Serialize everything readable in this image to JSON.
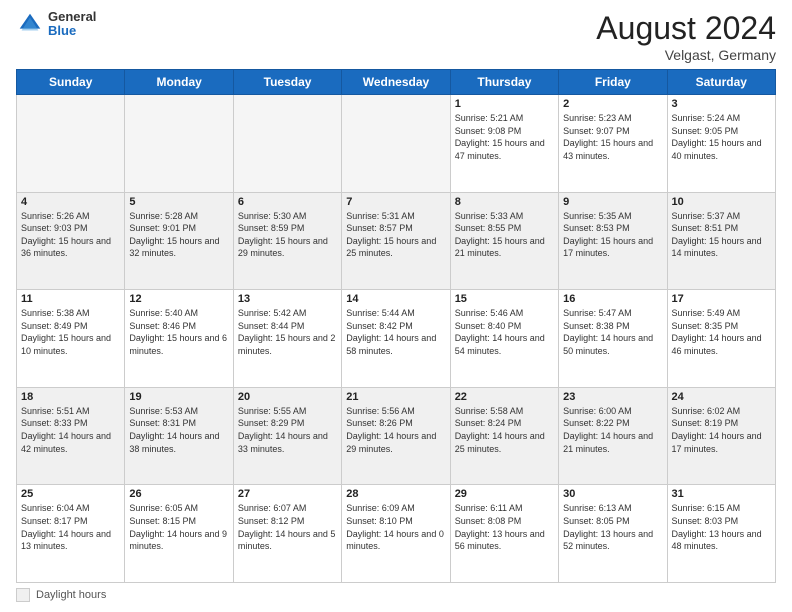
{
  "header": {
    "logo_general": "General",
    "logo_blue": "Blue",
    "title": "August 2024",
    "location": "Velgast, Germany"
  },
  "days_of_week": [
    "Sunday",
    "Monday",
    "Tuesday",
    "Wednesday",
    "Thursday",
    "Friday",
    "Saturday"
  ],
  "weeks": [
    [
      {
        "day": "",
        "info": "",
        "empty": true
      },
      {
        "day": "",
        "info": "",
        "empty": true
      },
      {
        "day": "",
        "info": "",
        "empty": true
      },
      {
        "day": "",
        "info": "",
        "empty": true
      },
      {
        "day": "1",
        "info": "Sunrise: 5:21 AM\nSunset: 9:08 PM\nDaylight: 15 hours and 47 minutes.",
        "empty": false
      },
      {
        "day": "2",
        "info": "Sunrise: 5:23 AM\nSunset: 9:07 PM\nDaylight: 15 hours and 43 minutes.",
        "empty": false
      },
      {
        "day": "3",
        "info": "Sunrise: 5:24 AM\nSunset: 9:05 PM\nDaylight: 15 hours and 40 minutes.",
        "empty": false
      }
    ],
    [
      {
        "day": "4",
        "info": "Sunrise: 5:26 AM\nSunset: 9:03 PM\nDaylight: 15 hours and 36 minutes.",
        "empty": false
      },
      {
        "day": "5",
        "info": "Sunrise: 5:28 AM\nSunset: 9:01 PM\nDaylight: 15 hours and 32 minutes.",
        "empty": false
      },
      {
        "day": "6",
        "info": "Sunrise: 5:30 AM\nSunset: 8:59 PM\nDaylight: 15 hours and 29 minutes.",
        "empty": false
      },
      {
        "day": "7",
        "info": "Sunrise: 5:31 AM\nSunset: 8:57 PM\nDaylight: 15 hours and 25 minutes.",
        "empty": false
      },
      {
        "day": "8",
        "info": "Sunrise: 5:33 AM\nSunset: 8:55 PM\nDaylight: 15 hours and 21 minutes.",
        "empty": false
      },
      {
        "day": "9",
        "info": "Sunrise: 5:35 AM\nSunset: 8:53 PM\nDaylight: 15 hours and 17 minutes.",
        "empty": false
      },
      {
        "day": "10",
        "info": "Sunrise: 5:37 AM\nSunset: 8:51 PM\nDaylight: 15 hours and 14 minutes.",
        "empty": false
      }
    ],
    [
      {
        "day": "11",
        "info": "Sunrise: 5:38 AM\nSunset: 8:49 PM\nDaylight: 15 hours and 10 minutes.",
        "empty": false
      },
      {
        "day": "12",
        "info": "Sunrise: 5:40 AM\nSunset: 8:46 PM\nDaylight: 15 hours and 6 minutes.",
        "empty": false
      },
      {
        "day": "13",
        "info": "Sunrise: 5:42 AM\nSunset: 8:44 PM\nDaylight: 15 hours and 2 minutes.",
        "empty": false
      },
      {
        "day": "14",
        "info": "Sunrise: 5:44 AM\nSunset: 8:42 PM\nDaylight: 14 hours and 58 minutes.",
        "empty": false
      },
      {
        "day": "15",
        "info": "Sunrise: 5:46 AM\nSunset: 8:40 PM\nDaylight: 14 hours and 54 minutes.",
        "empty": false
      },
      {
        "day": "16",
        "info": "Sunrise: 5:47 AM\nSunset: 8:38 PM\nDaylight: 14 hours and 50 minutes.",
        "empty": false
      },
      {
        "day": "17",
        "info": "Sunrise: 5:49 AM\nSunset: 8:35 PM\nDaylight: 14 hours and 46 minutes.",
        "empty": false
      }
    ],
    [
      {
        "day": "18",
        "info": "Sunrise: 5:51 AM\nSunset: 8:33 PM\nDaylight: 14 hours and 42 minutes.",
        "empty": false
      },
      {
        "day": "19",
        "info": "Sunrise: 5:53 AM\nSunset: 8:31 PM\nDaylight: 14 hours and 38 minutes.",
        "empty": false
      },
      {
        "day": "20",
        "info": "Sunrise: 5:55 AM\nSunset: 8:29 PM\nDaylight: 14 hours and 33 minutes.",
        "empty": false
      },
      {
        "day": "21",
        "info": "Sunrise: 5:56 AM\nSunset: 8:26 PM\nDaylight: 14 hours and 29 minutes.",
        "empty": false
      },
      {
        "day": "22",
        "info": "Sunrise: 5:58 AM\nSunset: 8:24 PM\nDaylight: 14 hours and 25 minutes.",
        "empty": false
      },
      {
        "day": "23",
        "info": "Sunrise: 6:00 AM\nSunset: 8:22 PM\nDaylight: 14 hours and 21 minutes.",
        "empty": false
      },
      {
        "day": "24",
        "info": "Sunrise: 6:02 AM\nSunset: 8:19 PM\nDaylight: 14 hours and 17 minutes.",
        "empty": false
      }
    ],
    [
      {
        "day": "25",
        "info": "Sunrise: 6:04 AM\nSunset: 8:17 PM\nDaylight: 14 hours and 13 minutes.",
        "empty": false
      },
      {
        "day": "26",
        "info": "Sunrise: 6:05 AM\nSunset: 8:15 PM\nDaylight: 14 hours and 9 minutes.",
        "empty": false
      },
      {
        "day": "27",
        "info": "Sunrise: 6:07 AM\nSunset: 8:12 PM\nDaylight: 14 hours and 5 minutes.",
        "empty": false
      },
      {
        "day": "28",
        "info": "Sunrise: 6:09 AM\nSunset: 8:10 PM\nDaylight: 14 hours and 0 minutes.",
        "empty": false
      },
      {
        "day": "29",
        "info": "Sunrise: 6:11 AM\nSunset: 8:08 PM\nDaylight: 13 hours and 56 minutes.",
        "empty": false
      },
      {
        "day": "30",
        "info": "Sunrise: 6:13 AM\nSunset: 8:05 PM\nDaylight: 13 hours and 52 minutes.",
        "empty": false
      },
      {
        "day": "31",
        "info": "Sunrise: 6:15 AM\nSunset: 8:03 PM\nDaylight: 13 hours and 48 minutes.",
        "empty": false
      }
    ]
  ],
  "footer": {
    "shaded_label": "Daylight hours"
  }
}
